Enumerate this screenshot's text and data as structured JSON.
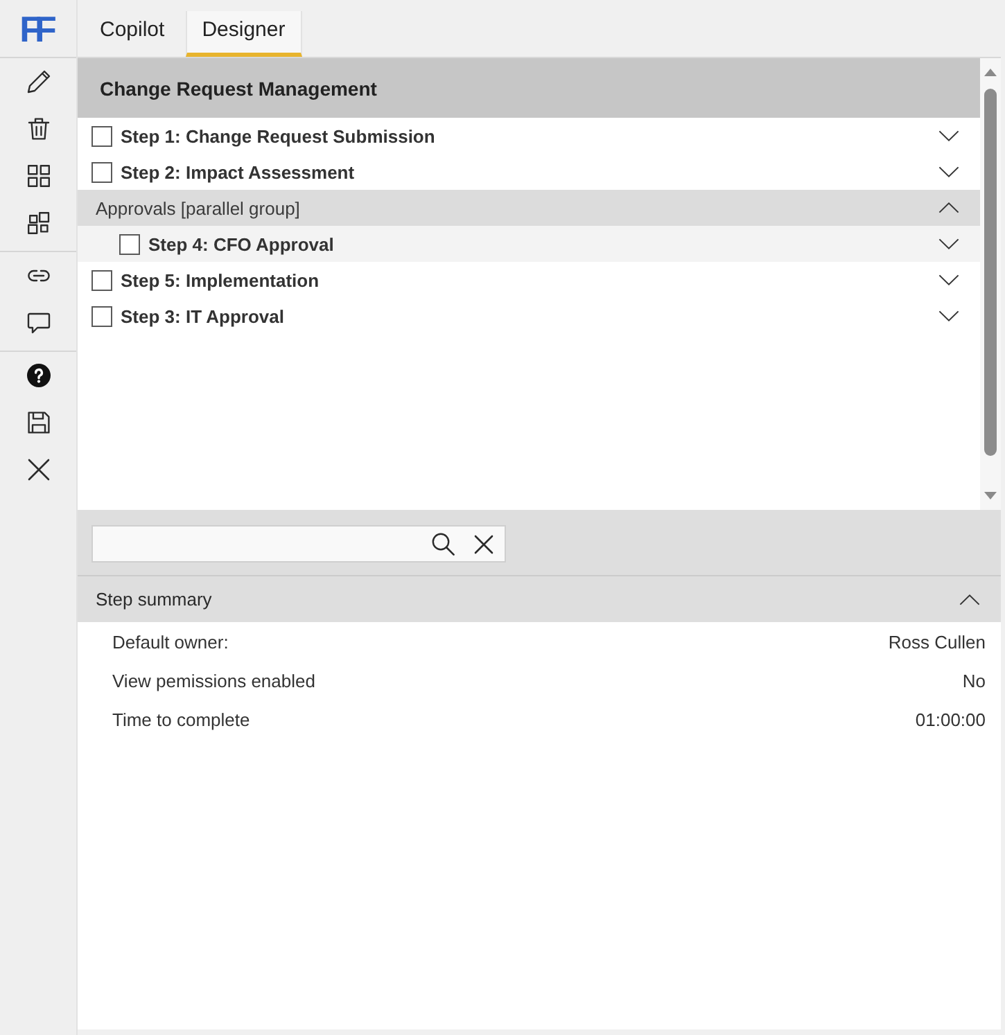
{
  "logo": "FF",
  "tabs": [
    {
      "label": "Copilot",
      "selected": false
    },
    {
      "label": "Designer",
      "selected": true
    }
  ],
  "process": {
    "title": "Change Request Management",
    "items": [
      {
        "kind": "step",
        "label": "Step 1: Change Request Submission",
        "checked": false,
        "expanded": false
      },
      {
        "kind": "step",
        "label": "Step 2: Impact Assessment",
        "checked": false,
        "expanded": false
      },
      {
        "kind": "group",
        "label": "Approvals [parallel group]",
        "expanded": true,
        "children": [
          {
            "kind": "step",
            "label": "Step 4: CFO Approval",
            "checked": false,
            "expanded": false
          }
        ]
      },
      {
        "kind": "step",
        "label": "Step 5: Implementation",
        "checked": false,
        "expanded": false
      },
      {
        "kind": "step",
        "label": "Step 3: IT Approval",
        "checked": false,
        "expanded": false
      }
    ]
  },
  "step_summary": {
    "title": "Step summary",
    "expanded": true,
    "properties": [
      {
        "label": "Default owner:",
        "value": "Ross Cullen"
      },
      {
        "label": "View pemissions enabled",
        "value": "No"
      },
      {
        "label": "Time to complete",
        "value": "01:00:00"
      }
    ]
  }
}
